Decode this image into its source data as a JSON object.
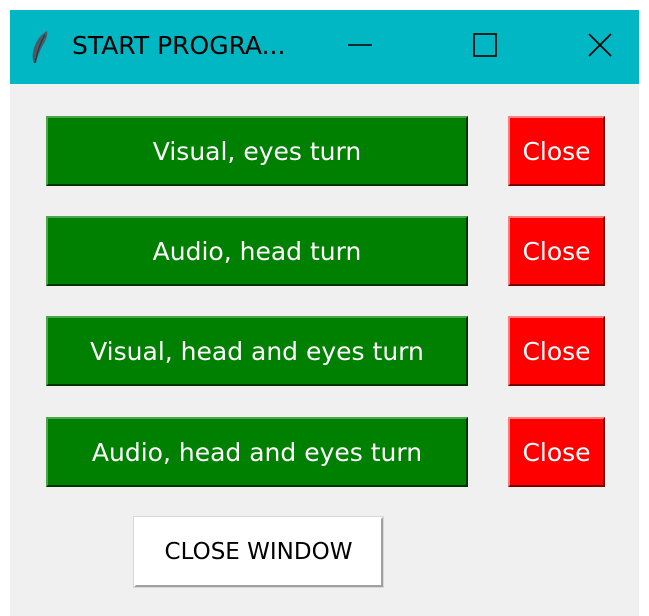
{
  "window": {
    "title": "START PROGRA...",
    "app_icon": "feather-icon",
    "controls": {
      "minimize_icon": "minimize-icon",
      "maximize_icon": "maximize-icon",
      "close_icon": "close-icon"
    },
    "titlebar_color": "#00b7c3",
    "background_color": "#f0f0f0"
  },
  "buttons": [
    {
      "label": "Visual, eyes turn",
      "close_label": "Close"
    },
    {
      "label": "Audio, head turn",
      "close_label": "Close"
    },
    {
      "label": "Visual, head and eyes turn",
      "close_label": "Close"
    },
    {
      "label": "Audio, head and eyes turn",
      "close_label": "Close"
    }
  ],
  "close_window": {
    "label": "CLOSE WINDOW"
  },
  "colors": {
    "action_button": "#008000",
    "close_button": "#ff0000",
    "close_window_button": "#ffffff"
  }
}
